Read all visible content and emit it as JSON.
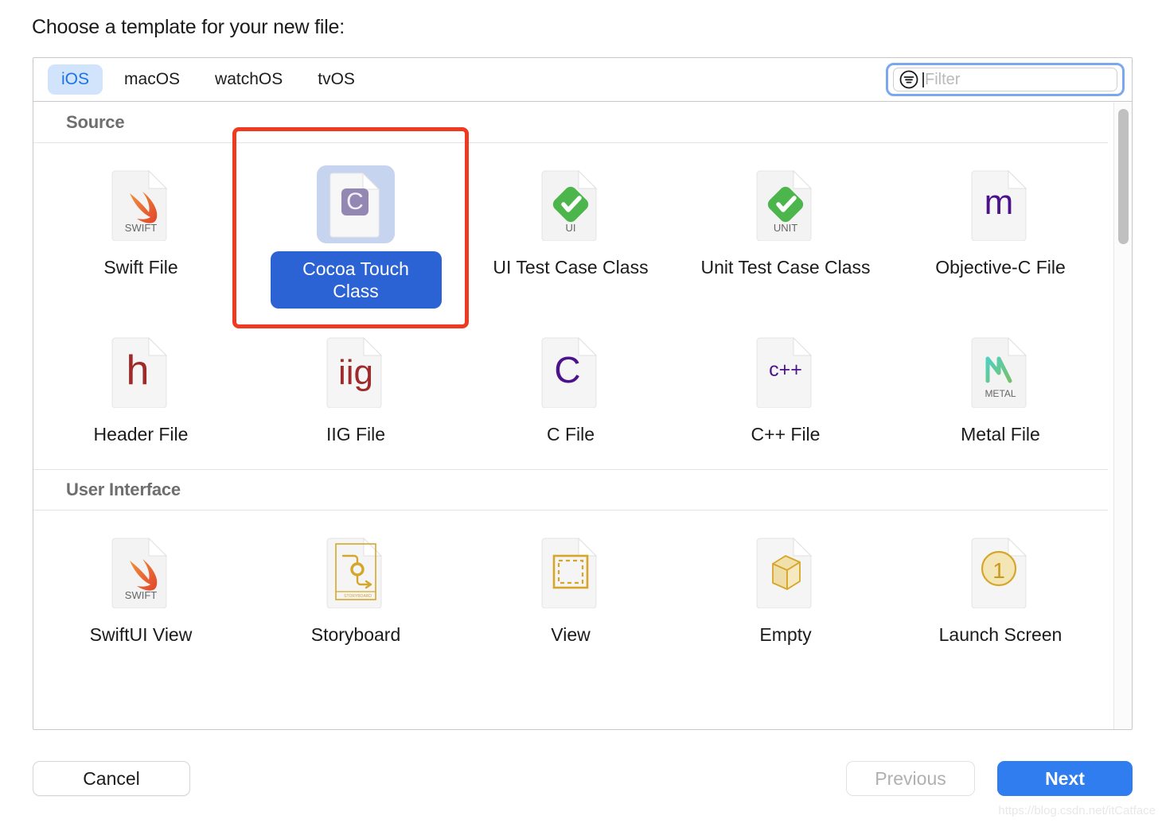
{
  "heading": "Choose a template for your new file:",
  "tabs": [
    {
      "label": "iOS",
      "active": true
    },
    {
      "label": "macOS",
      "active": false
    },
    {
      "label": "watchOS",
      "active": false
    },
    {
      "label": "tvOS",
      "active": false
    }
  ],
  "filter": {
    "placeholder": "Filter",
    "value": "",
    "icon": "filter-lines-circle-icon",
    "focused": true
  },
  "sections": [
    {
      "title": "Source",
      "items": [
        {
          "label": "Swift File",
          "icon": "swift-file-icon",
          "selected": false
        },
        {
          "label": "Cocoa Touch Class",
          "icon": "cocoa-touch-class-icon",
          "selected": true
        },
        {
          "label": "UI Test Case Class",
          "icon": "ui-test-case-icon",
          "selected": false
        },
        {
          "label": "Unit Test Case Class",
          "icon": "unit-test-case-icon",
          "selected": false
        },
        {
          "label": "Objective-C File",
          "icon": "objective-c-file-icon",
          "selected": false
        },
        {
          "label": "Header File",
          "icon": "header-file-icon",
          "selected": false
        },
        {
          "label": "IIG File",
          "icon": "iig-file-icon",
          "selected": false
        },
        {
          "label": "C File",
          "icon": "c-file-icon",
          "selected": false
        },
        {
          "label": "C++ File",
          "icon": "cpp-file-icon",
          "selected": false
        },
        {
          "label": "Metal File",
          "icon": "metal-file-icon",
          "selected": false
        }
      ]
    },
    {
      "title": "User Interface",
      "items": [
        {
          "label": "SwiftUI View",
          "icon": "swiftui-view-icon",
          "selected": false
        },
        {
          "label": "Storyboard",
          "icon": "storyboard-icon",
          "selected": false
        },
        {
          "label": "View",
          "icon": "view-icon",
          "selected": false
        },
        {
          "label": "Empty",
          "icon": "empty-icon",
          "selected": false
        },
        {
          "label": "Launch Screen",
          "icon": "launch-screen-icon",
          "selected": false
        }
      ]
    }
  ],
  "icon_badges": {
    "swift": "SWIFT",
    "ui_test": "UI",
    "unit_test": "UNIT",
    "objective_c": "m",
    "header": "h",
    "iig": "iig",
    "c": "C",
    "cpp": "c++",
    "metal": "METAL",
    "cocoa_touch": "C",
    "storyboard": "STORYBOARD",
    "launch_screen": "1"
  },
  "footer": {
    "cancel": "Cancel",
    "previous": "Previous",
    "next": "Next",
    "previous_disabled": true
  },
  "watermark": "https://blog.csdn.net/itCatface",
  "colors": {
    "accent_blue": "#2f7dee",
    "tab_active_bg": "#d2e3fc",
    "tab_active_text": "#1a73e8",
    "selection_blue": "#2b62d4",
    "selection_icon_bg": "#c6d4f0",
    "annotation_red": "#ef3a21",
    "swift_orange": "#e8622c",
    "test_green": "#4cb54c",
    "objc_purple": "#4b128c",
    "header_red": "#9e2a2a",
    "metal_green": "#4ec9a0",
    "gold": "#d6a62a"
  }
}
